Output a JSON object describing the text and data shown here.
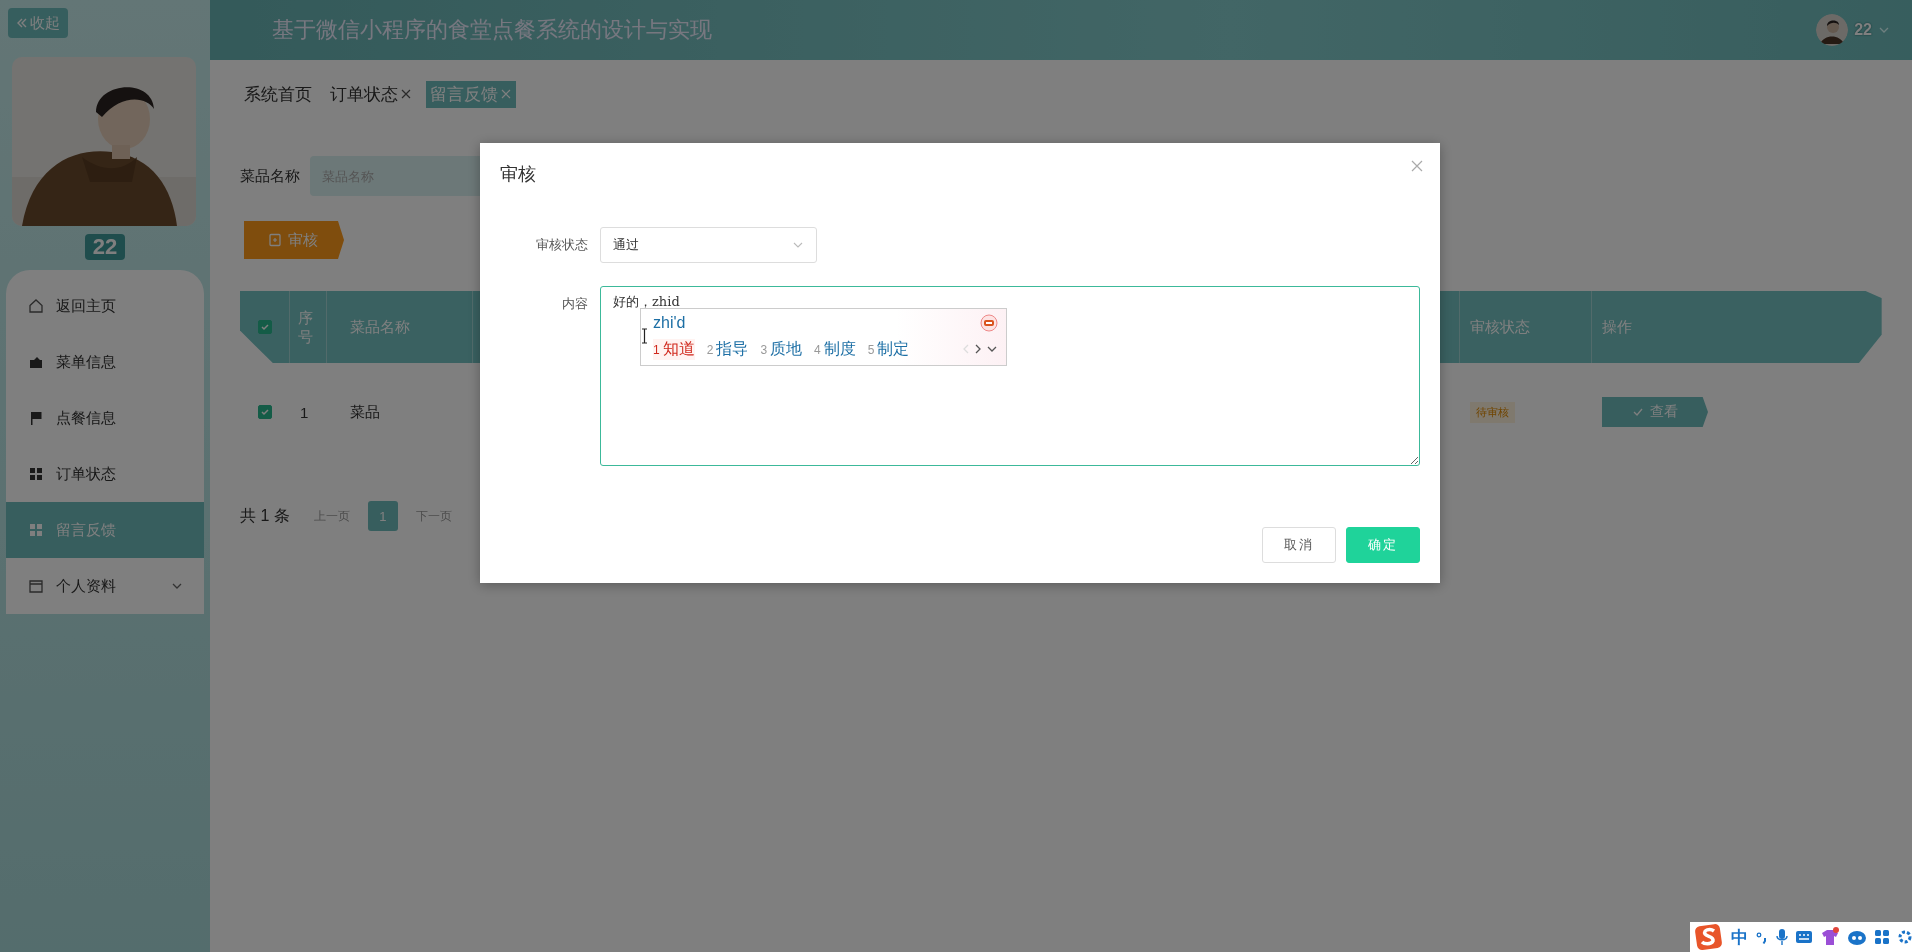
{
  "sidebar": {
    "collapse": {
      "label": "收起"
    },
    "user": {
      "name": "22"
    },
    "menu": [
      {
        "label": "返回主页",
        "selected": false,
        "expandable": false
      },
      {
        "label": "菜单信息",
        "selected": false,
        "expandable": false
      },
      {
        "label": "点餐信息",
        "selected": false,
        "expandable": false
      },
      {
        "label": "订单状态",
        "selected": false,
        "expandable": false
      },
      {
        "label": "留言反馈",
        "selected": true,
        "expandable": false
      },
      {
        "label": "个人资料",
        "selected": false,
        "expandable": true
      }
    ]
  },
  "header": {
    "title": "基于微信小程序的食堂点餐系统的设计与实现",
    "user": {
      "name": "22"
    }
  },
  "tabs": [
    {
      "label": "系统首页",
      "closable": false,
      "selected": false
    },
    {
      "label": "订单状态",
      "closable": true,
      "selected": false
    },
    {
      "label": "留言反馈",
      "closable": true,
      "selected": true
    }
  ],
  "search": {
    "label": "菜品名称",
    "placeholder": "菜品名称"
  },
  "review_button": {
    "label": "审核"
  },
  "table": {
    "header_checked": true,
    "columns": [
      "序号",
      "菜品名称",
      "审核状态",
      "操作"
    ],
    "rows": [
      {
        "checked": true,
        "cells": [
          "1",
          "菜品"
        ],
        "status": "待审核",
        "action": "查看"
      }
    ]
  },
  "pagination": {
    "total": "共 1 条",
    "prev": "上一页",
    "pages": [
      {
        "label": "1",
        "selected": true
      }
    ],
    "next": "下一页"
  },
  "dialog": {
    "title": "审核",
    "fields": [
      {
        "kind": "select",
        "label": "审核状态",
        "value": "通过"
      },
      {
        "kind": "textarea",
        "label": "内容",
        "value": "好的，zhid"
      }
    ],
    "buttons": [
      {
        "label": "取消",
        "kind": "default"
      },
      {
        "label": "确定",
        "kind": "primary"
      }
    ]
  },
  "ime": {
    "composition": "zhi'd",
    "candidates": [
      {
        "index": "1",
        "text": "知道",
        "selected": true
      },
      {
        "index": "2",
        "text": "指导",
        "selected": false
      },
      {
        "index": "3",
        "text": "质地",
        "selected": false
      },
      {
        "index": "4",
        "text": "制度",
        "selected": false
      },
      {
        "index": "5",
        "text": "制定",
        "selected": false
      }
    ]
  },
  "ime_toolbar": {
    "mode": "中"
  }
}
